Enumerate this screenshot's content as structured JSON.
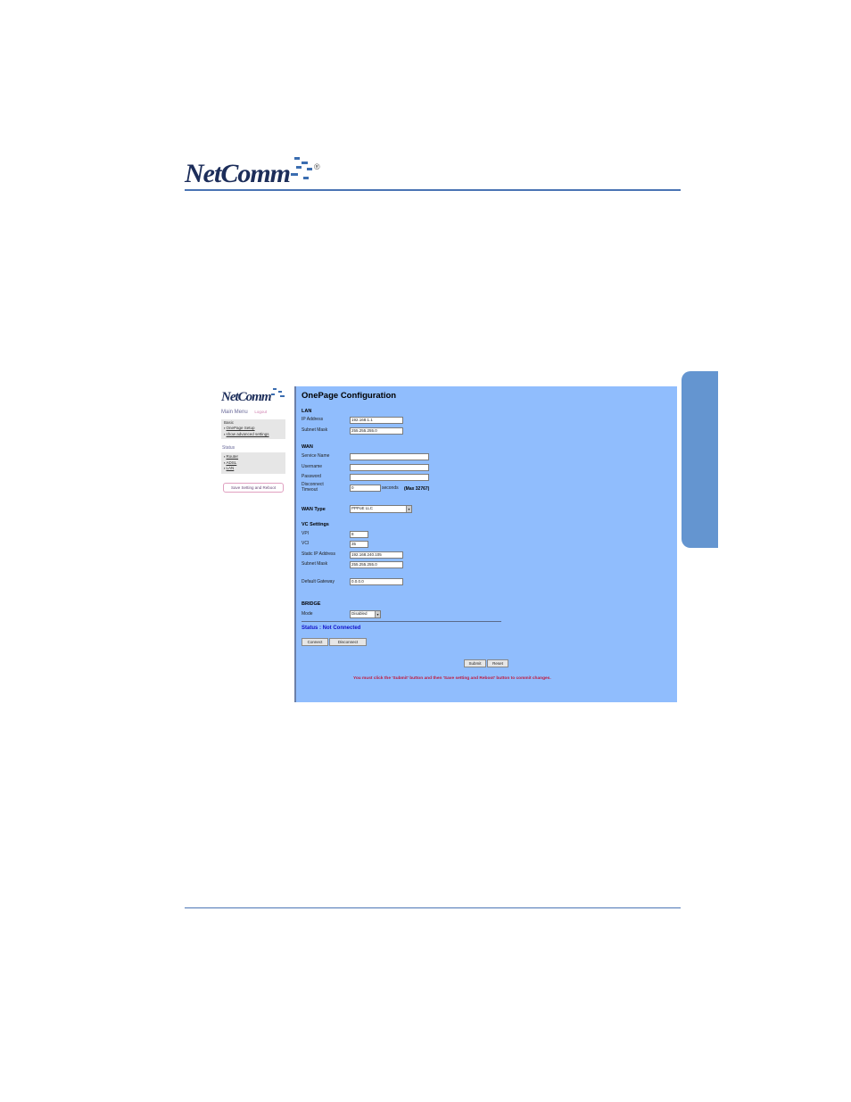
{
  "page": {
    "logo": "NetComm",
    "registered": "®"
  },
  "nav": {
    "logo": "NetComm",
    "main_menu": "Main Menu",
    "logout": "Logout",
    "basic_header": "Basic",
    "basic_items": [
      "OnePage Setup",
      "show advanced settings"
    ],
    "status_label": "Status",
    "status_items": [
      "Router",
      "ADSL",
      "LAN"
    ],
    "save_button": "Save Setting and Reboot"
  },
  "main": {
    "title": "OnePage Configuration",
    "lan": {
      "heading": "LAN",
      "ip_label": "IP Address",
      "ip_value": "192.168.1.1",
      "mask_label": "Subnet Mask",
      "mask_value": "255.255.255.0"
    },
    "wan": {
      "heading": "WAN",
      "service_label": "Service Name",
      "service_value": "",
      "username_label": "Username",
      "username_value": "",
      "password_label": "Password",
      "password_value": "",
      "disconnect_label_1": "Disconnect",
      "disconnect_label_2": "Timeout",
      "disconnect_value": "0",
      "seconds_text": "seconds",
      "max_text": "(Max 32767)"
    },
    "wan_type": {
      "label": "WAN Type",
      "value": "PPPoE LLC"
    },
    "vc": {
      "heading": "VC Settings",
      "vpi_label": "VPI",
      "vpi_value": "8",
      "vci_label": "VCI",
      "vci_value": "35",
      "static_ip_label": "Static IP Address",
      "static_ip_value": "192.168.240.105",
      "mask_label": "Subnet Mask",
      "mask_value": "255.255.255.0",
      "gateway_label": "Default Gateway",
      "gateway_value": "0.0.0.0"
    },
    "bridge": {
      "heading": "BRIDGE",
      "mode_label": "Mode",
      "mode_value": "Disabled"
    },
    "status": "Status : Not Connected",
    "connect_button": "Connect",
    "disconnect_button": "Disconnect",
    "submit_button": "Submit",
    "reset_button": "Reset",
    "warning": "You must click the 'Submit' button and then 'Save setting and Reboot' button to commit changes."
  }
}
